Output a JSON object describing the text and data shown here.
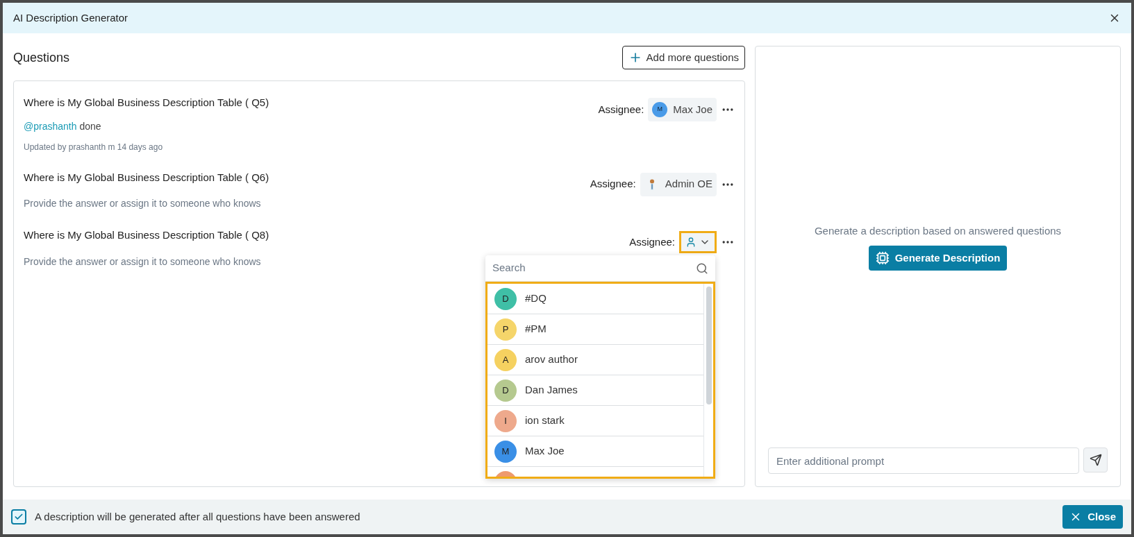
{
  "window": {
    "title": "AI Description Generator"
  },
  "questions_panel": {
    "title": "Questions",
    "add_button": "Add more questions"
  },
  "questions": [
    {
      "title": "Where is My Global Business Description Table ( Q5)",
      "answer": {
        "mention": "@prashanth",
        "text": "done",
        "answered": true
      },
      "meta": "Updated by prashanth m 14 days ago",
      "assignee_label": "Assignee:",
      "assignee": {
        "kind": "initial",
        "initial": "M",
        "name": "Max Joe",
        "color": "#4a9be8"
      },
      "menu_open": false
    },
    {
      "title": "Where is My Global Business Description Table ( Q6)",
      "answer": {
        "text": "Provide the answer or assign it to someone who knows",
        "answered": false
      },
      "assignee_label": "Assignee:",
      "assignee": {
        "kind": "photo",
        "name": "Admin OE"
      },
      "menu_open": false
    },
    {
      "title": "Where is My Global Business Description Table ( Q8)",
      "answer": {
        "text": "Provide the answer or assign it to someone who knows",
        "answered": false
      },
      "assignee_label": "Assignee:",
      "assignee": {
        "kind": "empty"
      },
      "menu_open": true
    }
  ],
  "assignee_menu": {
    "search": {
      "placeholder": "Search"
    },
    "users": [
      {
        "initial": "D",
        "name": "#DQ",
        "color": "#3fbfa6"
      },
      {
        "initial": "P",
        "name": "#PM",
        "color": "#f5d56a"
      },
      {
        "initial": "A",
        "name": "arov author",
        "color": "#f5d160"
      },
      {
        "initial": "D",
        "name": "Dan James",
        "color": "#b5c98f"
      },
      {
        "initial": "I",
        "name": "ion stark",
        "color": "#eea98c"
      },
      {
        "initial": "M",
        "name": "Max Joe",
        "color": "#3a8fe6"
      },
      {
        "color": "#ee9a6e"
      }
    ]
  },
  "generator_panel": {
    "hint": "Generate a description based on answered questions",
    "button": "Generate Description",
    "prompt": {
      "placeholder": "Enter additional prompt"
    }
  },
  "footer": {
    "checkbox": {
      "label": "A description will be generated after all questions have been answered",
      "checked": true
    },
    "close_button": "Close"
  }
}
